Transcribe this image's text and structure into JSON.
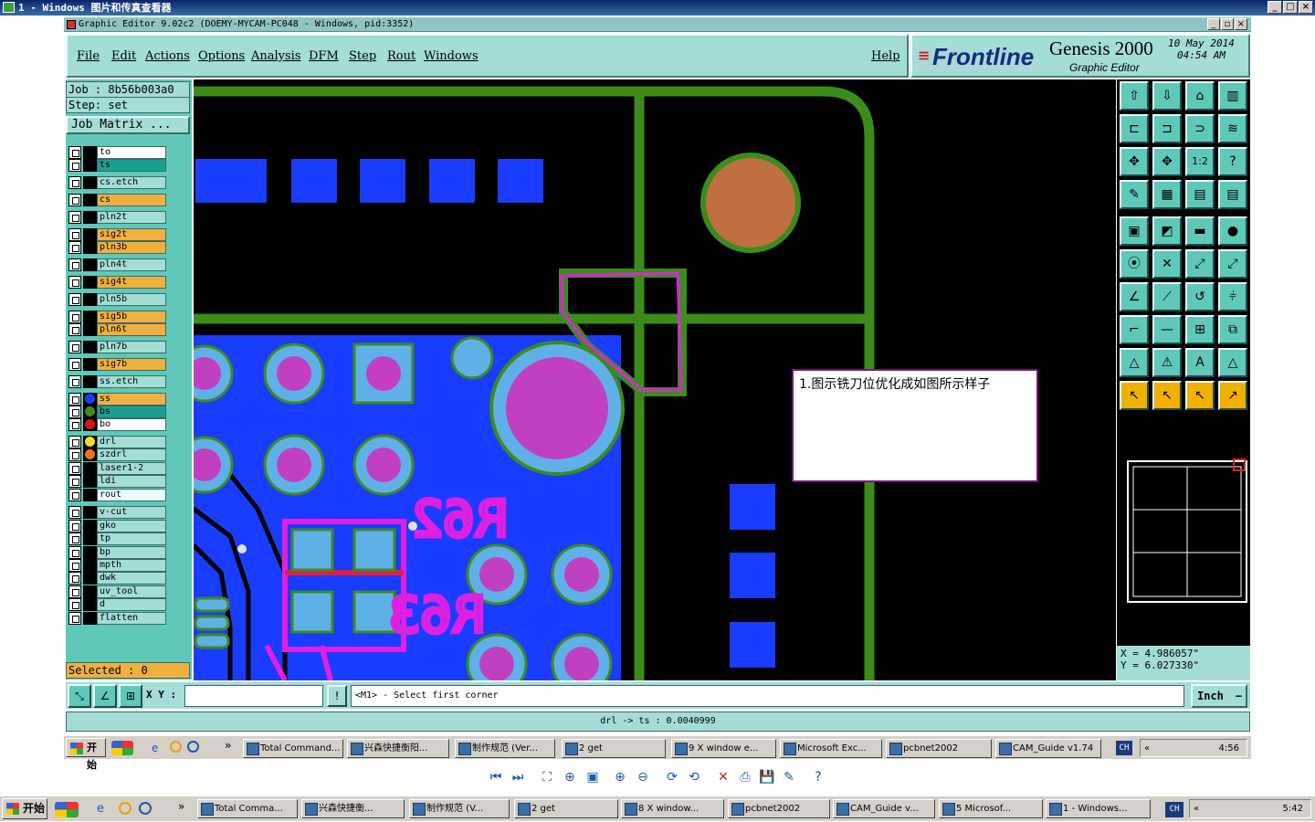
{
  "viewer": {
    "title": "1 - Windows 图片和传真查看器",
    "buttons": [
      "_",
      "□",
      "×"
    ]
  },
  "app": {
    "title": "Graphic Editor 9.02c2 (DOEMY-MYCAM-PC048 - Windows, pid:3352)",
    "menu": [
      "File",
      "Edit",
      "Actions",
      "Options",
      "Analysis",
      "DFM",
      "Step",
      "Rout",
      "Windows"
    ],
    "help": "Help",
    "brand": "Frontline",
    "product": "Genesis 2000",
    "product_sub": "Graphic Editor",
    "date": "10 May 2014",
    "time": "04:54 AM"
  },
  "job": {
    "job_label": "Job : 8b56b003a0",
    "step_label": "Step: set",
    "matrix_button": "Job Matrix ...",
    "selected": "Selected : 0"
  },
  "layers": [
    {
      "name": "to",
      "color": "#ffffff",
      "dot": ""
    },
    {
      "name": "ts",
      "color": "#1aa090",
      "dot": ""
    },
    {
      "name": "cs.etch",
      "color": "#a4dcd6",
      "dot": ""
    },
    {
      "name": "cs",
      "color": "#f0b040",
      "dot": ""
    },
    {
      "name": "pln2t",
      "color": "#a4dcd6",
      "dot": ""
    },
    {
      "name": "sig2t",
      "color": "#f0b040",
      "dot": ""
    },
    {
      "name": "pln3b",
      "color": "#f0b040",
      "dot": ""
    },
    {
      "name": "pln4t",
      "color": "#a4dcd6",
      "dot": ""
    },
    {
      "name": "sig4t",
      "color": "#f0b040",
      "dot": ""
    },
    {
      "name": "pln5b",
      "color": "#a4dcd6",
      "dot": ""
    },
    {
      "name": "sig5b",
      "color": "#f0b040",
      "dot": ""
    },
    {
      "name": "pln6t",
      "color": "#f0b040",
      "dot": ""
    },
    {
      "name": "pln7b",
      "color": "#a4dcd6",
      "dot": ""
    },
    {
      "name": "sig7b",
      "color": "#f0b040",
      "dot": ""
    },
    {
      "name": "ss.etch",
      "color": "#a4dcd6",
      "dot": ""
    },
    {
      "name": "ss",
      "color": "#f0b040",
      "dot": "#1a3cff"
    },
    {
      "name": "bs",
      "color": "#1aa090",
      "dot": "#3c8c1c"
    },
    {
      "name": "bo",
      "color": "#ffffff",
      "dot": "#e01010"
    },
    {
      "name": "drl",
      "color": "#a4dcd6",
      "dot": "#f0e020"
    },
    {
      "name": "szdrl",
      "color": "#a4dcd6",
      "dot": "#f07020"
    },
    {
      "name": "laser1-2",
      "color": "#a4dcd6",
      "dot": ""
    },
    {
      "name": "ldi",
      "color": "#a4dcd6",
      "dot": ""
    },
    {
      "name": "rout",
      "color": "#e6ffff",
      "dot": ""
    },
    {
      "name": "v-cut",
      "color": "#a4dcd6",
      "dot": ""
    },
    {
      "name": "gko",
      "color": "#a4dcd6",
      "dot": ""
    },
    {
      "name": "tp",
      "color": "#a4dcd6",
      "dot": ""
    },
    {
      "name": "bp",
      "color": "#a4dcd6",
      "dot": ""
    },
    {
      "name": "mpth",
      "color": "#a4dcd6",
      "dot": ""
    },
    {
      "name": "dwk",
      "color": "#a4dcd6",
      "dot": ""
    },
    {
      "name": "uv_tool",
      "color": "#a4dcd6",
      "dot": ""
    },
    {
      "name": "d",
      "color": "#a4dcd6",
      "dot": ""
    },
    {
      "name": "flatten",
      "color": "#a4dcd6",
      "dot": ""
    }
  ],
  "canvas": {
    "annotation": "1.图示铣刀位优化成如图所示样子",
    "silk_labels": [
      "R62",
      "R63"
    ]
  },
  "toolbox": {
    "coord_x": "X = 4.986057\"",
    "coord_y": "Y = 6.027330\""
  },
  "command": {
    "xy_label": "X Y :",
    "xy_value": "",
    "prompt": "<M1> - Select first corner",
    "units": "Inch",
    "status": "drl -> ts : 0.0040999"
  },
  "inner_taskbar": {
    "start": "开始",
    "tasks": [
      "Total Command...",
      "兴森快捷衡阳...",
      "制作规范 (Ver...",
      "2 get",
      "9 X window e...",
      "Microsoft Exc...",
      "pcbnet2002",
      "CAM_Guide v1.74"
    ],
    "lang": "CH",
    "clock": "4:56"
  },
  "outer_taskbar": {
    "start": "开始",
    "tasks": [
      "Total Comma...",
      "兴森快捷衡...",
      "制作规范 (V...",
      "2 get",
      "8 X window...",
      "pcbnet2002",
      "CAM_Guide v...",
      "5 Microsof...",
      "1 - Windows..."
    ],
    "lang": "CH",
    "clock": "5:42"
  },
  "viewer_tools": [
    "prev-icon",
    "next-icon",
    "fit-icon",
    "actual-size-icon",
    "slideshow-icon",
    "zoom-in-icon",
    "zoom-out-icon",
    "rotate-cw-icon",
    "rotate-ccw-icon",
    "delete-icon",
    "print-icon",
    "save-icon",
    "edit-icon",
    "help-icon"
  ]
}
